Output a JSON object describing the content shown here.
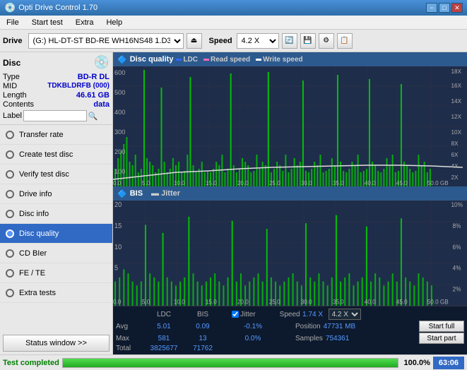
{
  "titlebar": {
    "title": "Opti Drive Control 1.70",
    "min": "−",
    "max": "□",
    "close": "✕"
  },
  "menubar": {
    "items": [
      "File",
      "Start test",
      "Extra",
      "Help"
    ]
  },
  "toolbar": {
    "drive_label": "Drive",
    "drive_value": "(G:) HL-DT-ST BD-RE  WH16NS48 1.D3",
    "speed_label": "Speed",
    "speed_value": "4.2 X"
  },
  "disc": {
    "title": "Disc",
    "type_label": "Type",
    "type_value": "BD-R DL",
    "mid_label": "MID",
    "mid_value": "TDKBLDRFB (000)",
    "length_label": "Length",
    "length_value": "46.61 GB",
    "contents_label": "Contents",
    "contents_value": "data",
    "label_label": "Label"
  },
  "nav": {
    "items": [
      {
        "id": "transfer-rate",
        "label": "Transfer rate",
        "active": false
      },
      {
        "id": "create-test-disc",
        "label": "Create test disc",
        "active": false
      },
      {
        "id": "verify-test-disc",
        "label": "Verify test disc",
        "active": false
      },
      {
        "id": "drive-info",
        "label": "Drive info",
        "active": false
      },
      {
        "id": "disc-info",
        "label": "Disc info",
        "active": false
      },
      {
        "id": "disc-quality",
        "label": "Disc quality",
        "active": true
      },
      {
        "id": "cd-bier",
        "label": "CD BIer",
        "active": false
      },
      {
        "id": "fe-te",
        "label": "FE / TE",
        "active": false
      },
      {
        "id": "extra-tests",
        "label": "Extra tests",
        "active": false
      }
    ],
    "status_btn": "Status window >>"
  },
  "chart": {
    "title": "Disc quality",
    "legend": [
      {
        "label": "LDC",
        "color": "#0000ff"
      },
      {
        "label": "Read speed",
        "color": "#ff69b4"
      },
      {
        "label": "Write speed",
        "color": "#ffffff"
      }
    ],
    "top": {
      "y_max": 600,
      "y_labels_right": [
        "18X",
        "16X",
        "14X",
        "12X",
        "10X",
        "8X",
        "6X",
        "4X",
        "2X"
      ],
      "x_labels": [
        "0.0",
        "5.0",
        "10.0",
        "15.0",
        "20.0",
        "25.0",
        "30.0",
        "35.0",
        "40.0",
        "45.0",
        "50.0 GB"
      ]
    },
    "bottom": {
      "title": "BIS",
      "legend2": "Jitter",
      "y_max": 20,
      "y_labels_right": [
        "10%",
        "8%",
        "6%",
        "4%",
        "2%"
      ],
      "x_labels": [
        "0.0",
        "5.0",
        "10.0",
        "15.0",
        "20.0",
        "25.0",
        "30.0",
        "35.0",
        "40.0",
        "45.0",
        "50.0 GB"
      ]
    },
    "stats": {
      "headers": [
        "LDC",
        "BIS",
        "",
        "Jitter",
        "Speed",
        "",
        ""
      ],
      "avg_label": "Avg",
      "avg_ldc": "5.01",
      "avg_bis": "0.09",
      "avg_jitter": "-0.1%",
      "max_label": "Max",
      "max_ldc": "581",
      "max_bis": "13",
      "max_jitter": "0.0%",
      "total_label": "Total",
      "total_ldc": "3825677",
      "total_bis": "71762",
      "speed_label": "Speed",
      "speed_value": "1.74 X",
      "position_label": "Position",
      "position_value": "47731 MB",
      "samples_label": "Samples",
      "samples_value": "754361",
      "jitter_checked": true,
      "speed_select": "4.2 X"
    }
  },
  "statusbar": {
    "label": "Test completed",
    "progress": 100.0,
    "progress_text": "100.0%",
    "score": "63:06"
  }
}
